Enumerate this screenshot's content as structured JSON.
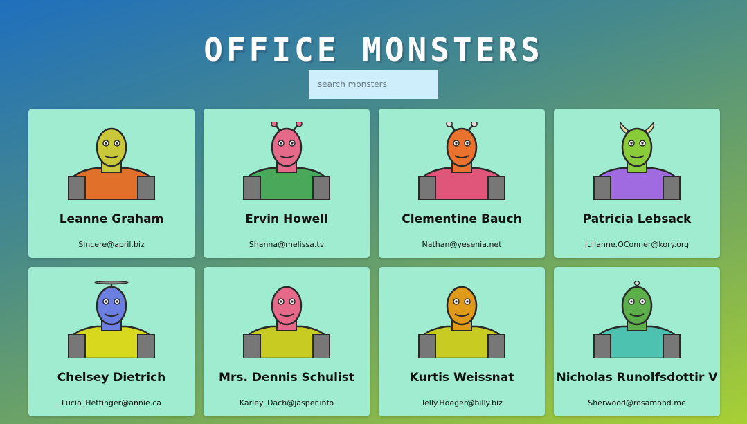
{
  "header": {
    "title": "OFFICE MONSTERS"
  },
  "search": {
    "placeholder": "search monsters",
    "value": ""
  },
  "monsters": [
    {
      "name": "Leanne Graham",
      "email": "Sincere@april.biz",
      "head": "#c9c83a",
      "body": "#e0702a",
      "accent": "#e0702a",
      "topper": "none"
    },
    {
      "name": "Ervin Howell",
      "email": "Shanna@melissa.tv",
      "head": "#e56a8a",
      "body": "#4aa85a",
      "accent": "#4aa85a",
      "topper": "antennae"
    },
    {
      "name": "Clementine Bauch",
      "email": "Nathan@yesenia.net",
      "head": "#e9722e",
      "body": "#e0567a",
      "accent": "#e0567a",
      "topper": "eyestalks"
    },
    {
      "name": "Patricia Lebsack",
      "email": "Julianne.OConner@kory.org",
      "head": "#8acb3a",
      "body": "#a06be0",
      "accent": "#a06be0",
      "topper": "horns"
    },
    {
      "name": "Chelsey Dietrich",
      "email": "Lucio_Hettinger@annie.ca",
      "head": "#6b7fe0",
      "body": "#d8d81e",
      "accent": "#d8d81e",
      "topper": "propeller"
    },
    {
      "name": "Mrs. Dennis Schulist",
      "email": "Karley_Dach@jasper.info",
      "head": "#e56a8a",
      "body": "#c8cc22",
      "accent": "#c8cc22",
      "topper": "none"
    },
    {
      "name": "Kurtis Weissnat",
      "email": "Telly.Hoeger@billy.biz",
      "head": "#e09a1a",
      "body": "#c8cc22",
      "accent": "#c8cc22",
      "topper": "none"
    },
    {
      "name": "Nicholas Runolfsdottir V",
      "email": "Sherwood@rosamond.me",
      "head": "#5cae4a",
      "body": "#4ec2b0",
      "accent": "#4ec2b0",
      "topper": "eyestalk"
    }
  ],
  "colors": {
    "card_bg": "#9fecd1",
    "search_bg": "#cdeefa",
    "title": "#ffffff"
  }
}
